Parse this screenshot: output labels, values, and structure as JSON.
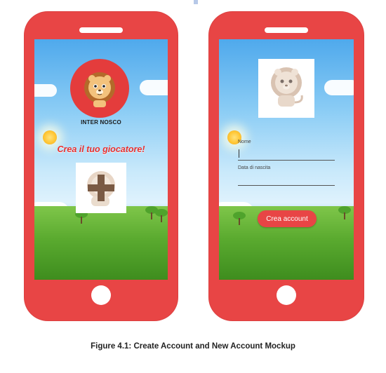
{
  "left_screen": {
    "app_name": "INTER NOSCO",
    "heading": "Crea il tuo giocatore!"
  },
  "right_screen": {
    "name_label": "Nome",
    "birthdate_label": "Data di nascita",
    "create_button": "Crea account"
  },
  "caption": "Figure  4.1: Create Account and New Account Mockup",
  "colors": {
    "phone_body": "#e84545",
    "accent_red": "#e63030",
    "sky": "#8ccdf5",
    "grass": "#5aaa2f"
  },
  "icons": {
    "lion_logo": "lion-logo-icon",
    "add_avatar": "add-avatar-icon",
    "lion_avatar": "lion-avatar-icon"
  }
}
